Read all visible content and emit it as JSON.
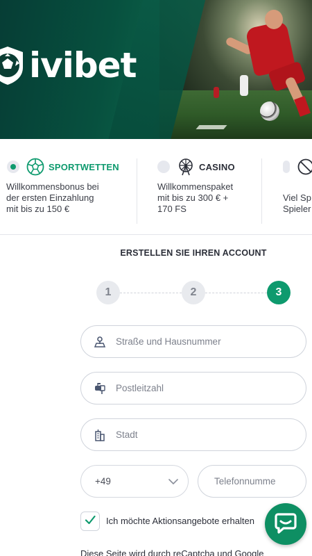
{
  "brand": {
    "name": "ivibet",
    "logo_icon": "soccer-ball-shield-icon"
  },
  "products": [
    {
      "title": "SPORTWETTEN",
      "icon": "soccer-ball-icon",
      "selected": true,
      "desc_line1": "Willkommensbonus bei",
      "desc_line2": "der ersten Einzahlung",
      "desc_line3": "mit bis zu 150 €"
    },
    {
      "title": "CASINO",
      "icon": "ferris-wheel-icon",
      "selected": false,
      "desc_line1": "Willkommenspaket",
      "desc_line2": "mit bis zu 300 € +",
      "desc_line3": "170 FS"
    },
    {
      "title": "",
      "icon": "no-bonus-icon",
      "selected": false,
      "desc_line1": "",
      "desc_line2": "Viel Sp",
      "desc_line3": "Spieler"
    }
  ],
  "form": {
    "title": "ERSTELLEN SIE IHREN ACCOUNT",
    "steps": [
      "1",
      "2",
      "3"
    ],
    "active_step": 3,
    "street_placeholder": "Straße und Hausnummer",
    "zip_placeholder": "Postleitzahl",
    "city_placeholder": "Stadt",
    "country_code": "+49",
    "phone_placeholder": "Telefonnumme",
    "promo_checkbox_label": "Ich möchte Aktionsangebote erhalten",
    "promo_checked": true,
    "recaptcha_text": "Diese Seite wird durch reCaptcha und Google"
  },
  "colors": {
    "accent": "#0e9a6e",
    "hero_dark": "#063d35"
  }
}
